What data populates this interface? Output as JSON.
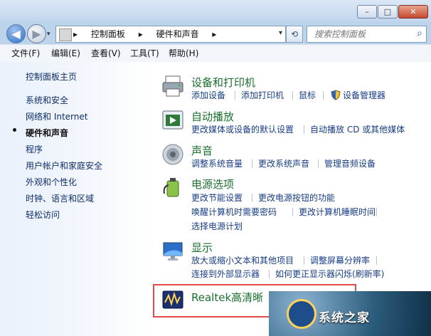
{
  "window": {
    "minimize": "–",
    "maximize": "□",
    "close": "✕"
  },
  "nav": {
    "back": "◀",
    "forward": "▶",
    "history_dropdown": "▾",
    "breadcrumb": [
      "控制面板",
      "硬件和声音"
    ],
    "address_dropdown": "▾",
    "refresh": "⟲",
    "search_placeholder": "搜索控制面板",
    "search_icon": "⌕"
  },
  "menu": [
    "文件(F)",
    "编辑(E)",
    "查看(V)",
    "工具(T)",
    "帮助(H)"
  ],
  "sidebar": {
    "items": [
      {
        "label": "控制面板主页",
        "active": false
      },
      {
        "label": "系统和安全",
        "active": false
      },
      {
        "label": "网络和 Internet",
        "active": false
      },
      {
        "label": "硬件和声音",
        "active": true
      },
      {
        "label": "程序",
        "active": false
      },
      {
        "label": "用户帐户和家庭安全",
        "active": false
      },
      {
        "label": "外观和个性化",
        "active": false
      },
      {
        "label": "时钟、语言和区域",
        "active": false
      },
      {
        "label": "轻松访问",
        "active": false
      }
    ]
  },
  "categories": [
    {
      "title": "设备和打印机",
      "icon": "printer-icon",
      "links": [
        "添加设备",
        "添加打印机",
        "鼠标",
        "设备管理器"
      ]
    },
    {
      "title": "自动播放",
      "icon": "autoplay-icon",
      "links": [
        "更改媒体或设备的默认设置",
        "自动播放 CD 或其他媒体"
      ]
    },
    {
      "title": "声音",
      "icon": "speaker-icon",
      "links": [
        "调整系统音量",
        "更改系统声音",
        "管理音频设备"
      ]
    },
    {
      "title": "电源选项",
      "icon": "power-icon",
      "links": [
        "更改节能设置",
        "更改电源按钮的功能",
        "唤醒计算机时需要密码",
        "更改计算机睡眠时间",
        "选择电源计划"
      ]
    },
    {
      "title": "显示",
      "icon": "display-icon",
      "links": [
        "放大或缩小文本和其他项目",
        "调整屏幕分辨率",
        "连接到外部显示器",
        "如何更正显示器闪烁(刷新率)"
      ]
    },
    {
      "title": "Realtek高清晰",
      "icon": "realtek-icon",
      "links": []
    }
  ],
  "watermark": {
    "text": "系统之家"
  }
}
